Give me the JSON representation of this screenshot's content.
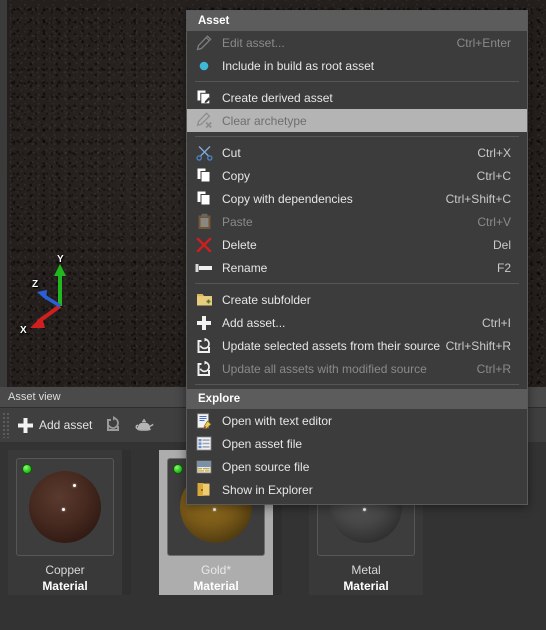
{
  "viewport": {
    "gizmo": {
      "axis_y": "Y",
      "axis_x": "X",
      "axis_z": "Z"
    }
  },
  "asset_view": {
    "panel_title": "Asset view",
    "toolbar": {
      "add_asset_label": "Add asset",
      "refresh_icon": "refresh-icon",
      "teapot_icon": "teapot-icon"
    },
    "cards": [
      {
        "name": "Copper",
        "type": "Material",
        "selected": false,
        "status": "ok"
      },
      {
        "name": "Gold*",
        "type": "Material",
        "selected": true,
        "status": "ok"
      },
      {
        "name": "Metal",
        "type": "Material",
        "selected": false,
        "status": "ok"
      }
    ]
  },
  "context_menu": {
    "header": "Asset",
    "explore_header": "Explore",
    "groups": [
      {
        "items": [
          {
            "label": "Edit asset...",
            "shortcut": "Ctrl+Enter",
            "icon": "pencil-icon",
            "disabled": true,
            "highlight": false
          },
          {
            "label": "Include in build as root asset",
            "shortcut": "",
            "icon": "bullet-dot-icon",
            "disabled": false,
            "highlight": false
          }
        ]
      },
      {
        "items": [
          {
            "label": "Create derived asset",
            "shortcut": "",
            "icon": "copy-pencil-icon",
            "disabled": false,
            "highlight": false
          },
          {
            "label": "Clear archetype",
            "shortcut": "",
            "icon": "pencil-x-icon",
            "disabled": true,
            "highlight": true
          }
        ]
      },
      {
        "items": [
          {
            "label": "Cut",
            "shortcut": "Ctrl+X",
            "icon": "scissors-icon",
            "disabled": false,
            "highlight": false
          },
          {
            "label": "Copy",
            "shortcut": "Ctrl+C",
            "icon": "copy-icon",
            "disabled": false,
            "highlight": false
          },
          {
            "label": "Copy with dependencies",
            "shortcut": "Ctrl+Shift+C",
            "icon": "copy-icon",
            "disabled": false,
            "highlight": false
          },
          {
            "label": "Paste",
            "shortcut": "Ctrl+V",
            "icon": "clipboard-icon",
            "disabled": true,
            "highlight": false
          },
          {
            "label": "Delete",
            "shortcut": "Del",
            "icon": "delete-x-icon",
            "disabled": false,
            "highlight": false
          },
          {
            "label": "Rename",
            "shortcut": "F2",
            "icon": "rename-icon",
            "disabled": false,
            "highlight": false
          }
        ]
      },
      {
        "items": [
          {
            "label": "Create subfolder",
            "shortcut": "",
            "icon": "folder-new-icon",
            "disabled": false,
            "highlight": false
          },
          {
            "label": "Add asset...",
            "shortcut": "Ctrl+I",
            "icon": "plus-icon",
            "disabled": false,
            "highlight": false
          },
          {
            "label": "Update selected assets from their source",
            "shortcut": "Ctrl+Shift+R",
            "icon": "update-icon",
            "disabled": false,
            "highlight": false
          },
          {
            "label": "Update all assets with modified source",
            "shortcut": "Ctrl+R",
            "icon": "update-icon",
            "disabled": true,
            "highlight": false
          }
        ]
      }
    ],
    "explore_items": [
      {
        "label": "Open with text editor",
        "shortcut": "",
        "icon": "text-editor-icon",
        "disabled": false,
        "highlight": false
      },
      {
        "label": "Open asset file",
        "shortcut": "",
        "icon": "asset-file-icon",
        "disabled": false,
        "highlight": false
      },
      {
        "label": "Open source file",
        "shortcut": "",
        "icon": "source-file-icon",
        "disabled": false,
        "highlight": false
      },
      {
        "label": "Show in Explorer",
        "shortcut": "",
        "icon": "folder-open-icon",
        "disabled": false,
        "highlight": false
      }
    ]
  },
  "colors": {
    "menu_bg": "#3c3c3c",
    "menu_header_bg": "#5c5c5c",
    "highlight_bg": "#b4b4b4",
    "selected_card_bg": "#adadad",
    "status_ok": "#2fc21f",
    "accent_blue": "#3eb8d8"
  }
}
